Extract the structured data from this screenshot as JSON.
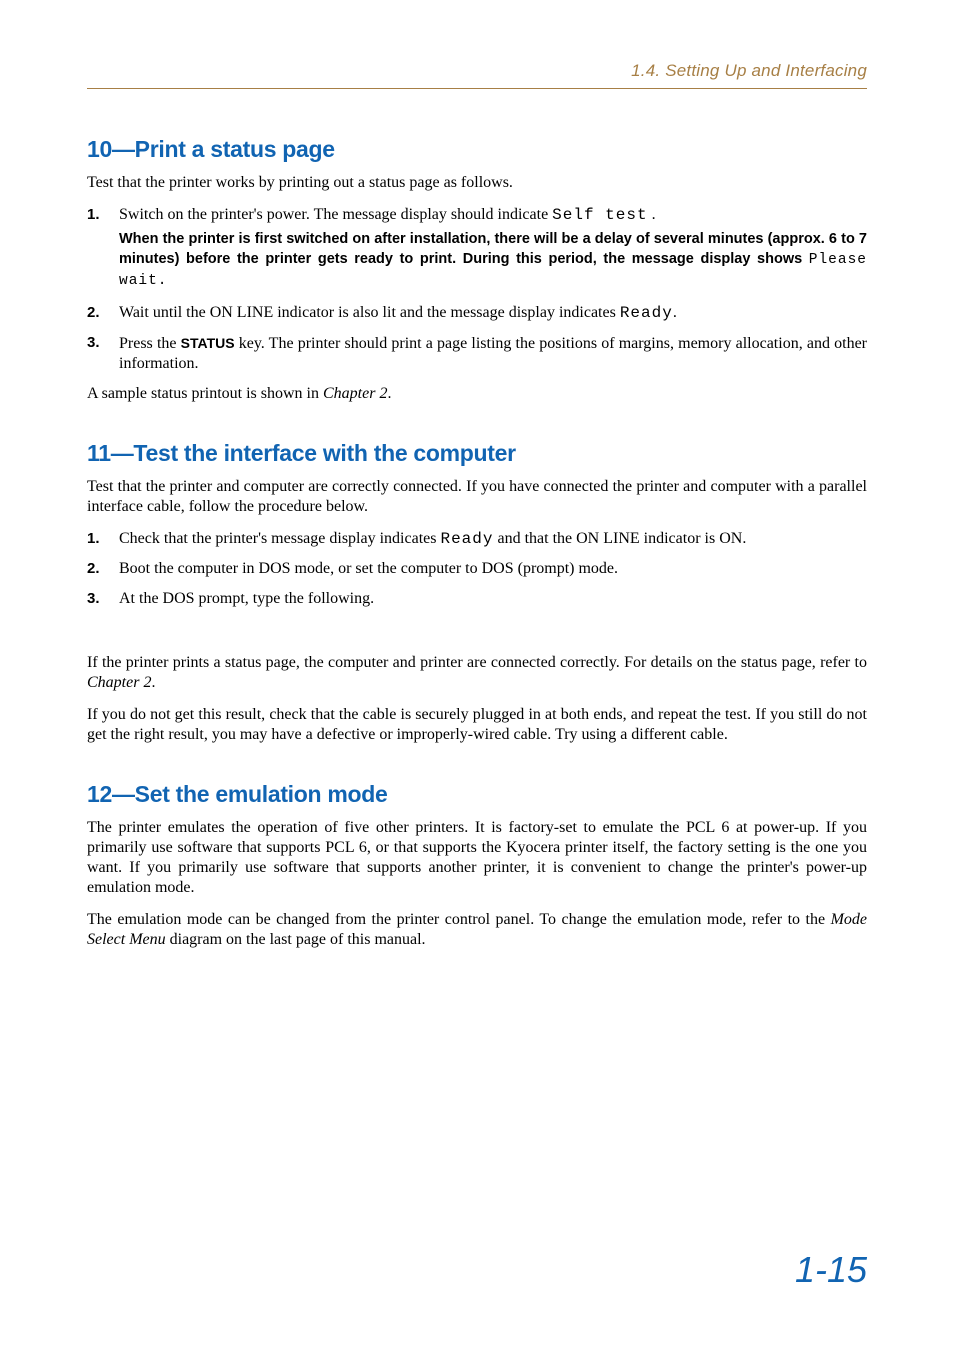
{
  "header": {
    "breadcrumb": "1.4. Setting Up and Interfacing"
  },
  "sections": {
    "s10": {
      "title": "10—Print a status page",
      "intro": "Test that the printer works by printing out a status page as follows.",
      "steps": {
        "step1": {
          "num": "1.",
          "text_a": "Switch on the printer's power. The message display should indicate ",
          "lcd": "Self test",
          "text_b": " ."
        },
        "note": {
          "text_a": "When the printer is first switched on after installation, there will be a delay of several minutes (approx. 6 to 7 minutes) before the printer gets ready to print. During this period, the message display shows ",
          "lcd": "Please wait.",
          "text_b": ""
        },
        "step2": {
          "num": "2.",
          "text_a": "Wait until the ON LINE indicator is also lit and the message display indicates ",
          "lcd": "Ready",
          "text_b": "."
        },
        "step3": {
          "num": "3.",
          "text_a": "Press the ",
          "key": "STATUS",
          "text_b": " key. The printer should print a page listing the positions of margins, memory allocation, and other information."
        }
      },
      "outro": {
        "text_a": "A sample status printout is shown in ",
        "em": "Chapter 2",
        "text_b": "."
      }
    },
    "s11": {
      "title": "11—Test the interface with the computer",
      "intro": "Test that the printer and computer are correctly connected. If you have connected the printer and computer with a parallel interface cable, follow the procedure below.",
      "steps": {
        "step1": {
          "num": "1.",
          "text_a": "Check that the printer's message display indicates ",
          "lcd": "Ready",
          "text_b": " and that the ON LINE indicator is ON."
        },
        "step2": {
          "num": "2.",
          "text": "Boot the computer in DOS mode, or set the computer to DOS (prompt) mode."
        },
        "step3": {
          "num": "3.",
          "text": "At the DOS prompt, type the following."
        }
      },
      "outro1": {
        "text_a": "If the printer prints a status page, the computer and printer are connected correctly. For details on the status page, refer to ",
        "em": "Chapter 2",
        "text_b": "."
      },
      "outro2": "If you do not get this result, check that the cable is securely plugged in at both ends, and repeat the test. If you still do not get the right result, you may have a defective or improperly-wired cable. Try using a different cable."
    },
    "s12": {
      "title": "12—Set the emulation mode",
      "p1": "The printer emulates the operation of five other printers. It is factory-set to emulate the PCL 6 at power-up. If you primarily use software that supports PCL 6, or that supports the Kyocera printer itself, the factory setting is the one you want. If you primarily use software that supports another printer, it is convenient to change the printer's power-up emulation mode.",
      "p2": {
        "text_a": "The emulation mode can be changed from the printer control panel. To change the emulation mode, refer to the ",
        "em": "Mode Select Menu",
        "text_b": " diagram on the last page of this manual."
      }
    }
  },
  "footer": {
    "page_number": "1-15"
  }
}
